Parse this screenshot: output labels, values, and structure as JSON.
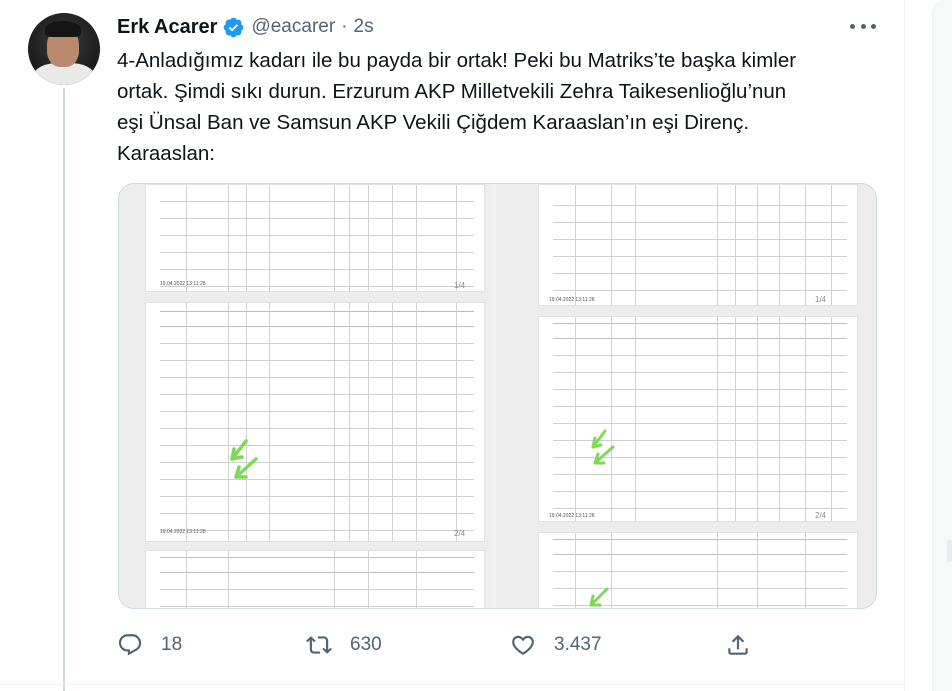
{
  "tweet": {
    "author_name": "Erk Acarer",
    "handle": "@eacarer",
    "separator": "·",
    "time": "2s",
    "text_lines": [
      "4-Anladığımız kadarı ile bu payda bir ortak! Peki bu Matriks’te başka kimler",
      "ortak. Şimdi sıkı durun. Erzurum AKP Milletvekili Zehra Taikesenlioğlu’nun",
      "eşi Ünsal Ban ve Samsun AKP Vekili Çiğdem Karaaslan’ın eşi Direnç.",
      "Karaaslan:"
    ]
  },
  "media": {
    "left_page_labels": [
      "1/4",
      "2/4"
    ],
    "right_page_labels": [
      "1/4",
      "2/4"
    ],
    "left_stamps": [
      "19.04.2022 13:11:28",
      "19.04.2022 13:11:28"
    ],
    "right_stamps": [
      "19.04.2022 13:11:28",
      "19.04.2022 13:11:28"
    ]
  },
  "actions": {
    "reply_count": "18",
    "retweet_count": "630",
    "like_count": "3.437"
  },
  "colors": {
    "accent": "#1d9bf0",
    "secondary_text": "#536471",
    "arrow_green": "#7ed957"
  },
  "icons": {
    "verified": "verified-badge-icon",
    "more": "more-options-icon",
    "reply": "reply-icon",
    "retweet": "retweet-icon",
    "like": "heart-icon",
    "share": "share-icon"
  }
}
